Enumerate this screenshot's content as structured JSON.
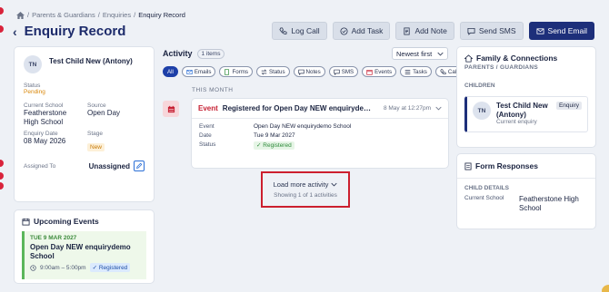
{
  "breadcrumb": {
    "items": [
      "Parents & Guardians",
      "Enquiries",
      "Enquiry Record"
    ],
    "sep": "/"
  },
  "header": {
    "title": "Enquiry Record",
    "back_glyph": "‹"
  },
  "actions": {
    "log_call": "Log Call",
    "add_task": "Add Task",
    "add_note": "Add Note",
    "send_sms": "Send SMS",
    "send_email": "Send Email"
  },
  "profile": {
    "initials": "TN",
    "name": "Test Child New (Antony)",
    "status_label": "Status",
    "status_value": "Pending",
    "current_school_label": "Current School",
    "current_school_value": "Featherstone High School",
    "source_label": "Source",
    "source_value": "Open Day",
    "enquiry_date_label": "Enquiry Date",
    "enquiry_date_value": "08 May 2026",
    "stage_label": "Stage",
    "stage_value": "New",
    "assigned_label": "Assigned To",
    "assigned_value": "Unassigned"
  },
  "upcoming": {
    "title": "Upcoming Events",
    "event": {
      "date": "TUE 9 MAR 2027",
      "name": "Open Day NEW enquirydemo School",
      "time": "9:00am – 5:00pm",
      "status": "Registered"
    }
  },
  "activity": {
    "title": "Activity",
    "count": "1 items",
    "sort": "Newest first",
    "filters": [
      "All",
      "Emails",
      "Forms",
      "Status",
      "Notes",
      "SMS",
      "Events",
      "Tasks",
      "Calls"
    ],
    "period": "THIS MONTH",
    "item": {
      "type": "Event",
      "description": "Registered for Open Day NEW enquirydem...",
      "date": "8 May at 12:27pm",
      "details": [
        {
          "key": "Event",
          "value": "Open Day NEW enquirydemo School"
        },
        {
          "key": "Date",
          "value": "Tue 9 Mar 2027"
        },
        {
          "key": "Status",
          "value": "Registered"
        }
      ]
    },
    "load_more": "Load more activity",
    "showing": "Showing 1 of 1 activities"
  },
  "family": {
    "title": "Family & Connections",
    "subtitle": "PARENTS / GUARDIANS",
    "children_label": "CHILDREN",
    "child": {
      "initials": "TN",
      "name": "Test Child New (Antony)",
      "relation": "Current enquiry",
      "badge": "Enquiry"
    }
  },
  "forms": {
    "title": "Form Responses",
    "section": "CHILD DETAILS",
    "row": {
      "label": "Current School",
      "value": "Featherstone High School"
    }
  },
  "colors": {
    "primary": "#1d2f7a",
    "event_red": "#c62033",
    "pending": "#d9870a",
    "success": "#2d8a3a",
    "highlight_box": "#cc1f2e"
  }
}
